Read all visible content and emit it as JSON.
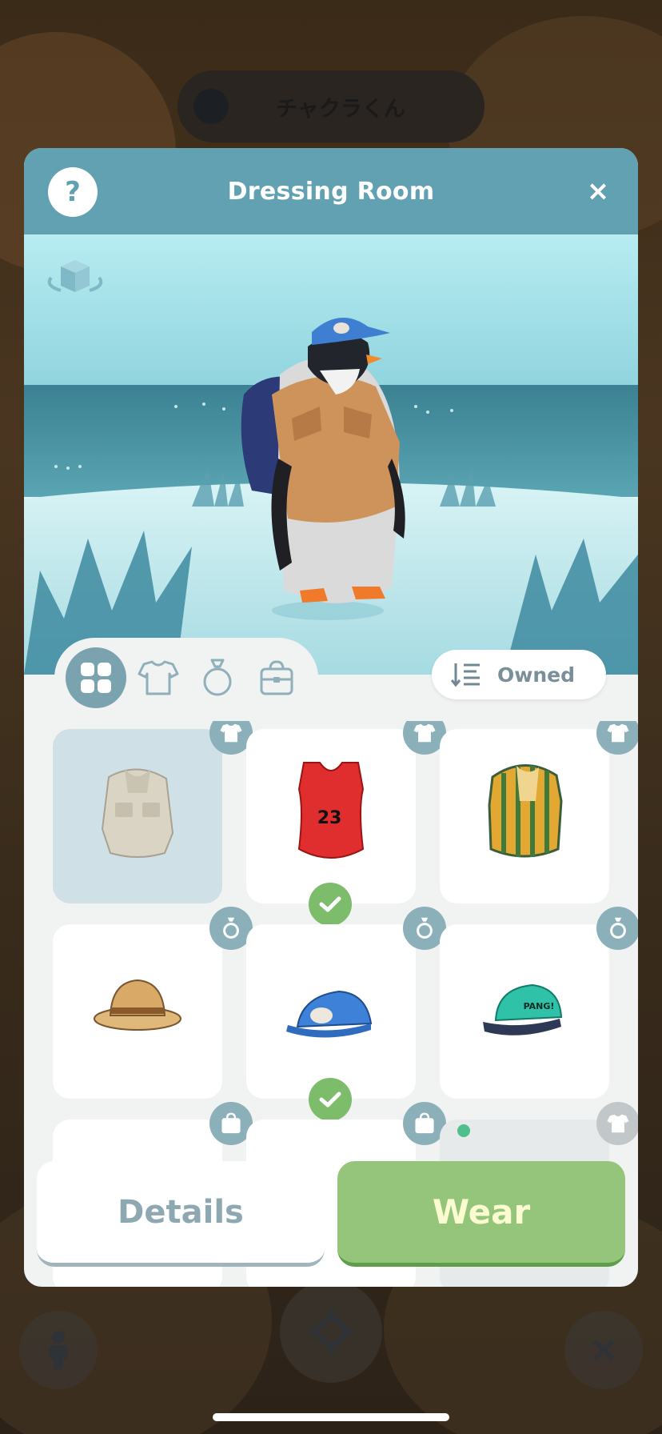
{
  "background": {
    "character_name": "チャクラくん",
    "nav_icons": [
      "person-icon",
      "locate-icon",
      "close-icon"
    ]
  },
  "dialog": {
    "title": "Dressing Room",
    "help_label": "?",
    "close_label": "×"
  },
  "preview": {
    "rotate_icon": "rotate-3d-icon",
    "character": "penguin"
  },
  "tabs": [
    {
      "icon": "grid-icon",
      "active": true
    },
    {
      "icon": "shirt-icon",
      "active": false
    },
    {
      "icon": "ring-icon",
      "active": false
    },
    {
      "icon": "bag-icon",
      "active": false
    }
  ],
  "sort": {
    "label": "Owned",
    "icon": "sort-list-icon"
  },
  "items": [
    {
      "name": "safari-shirt",
      "category": "shirt",
      "selected": true,
      "worn": false
    },
    {
      "name": "basketball-jersey",
      "category": "shirt",
      "selected": false,
      "worn": true,
      "jersey_text": "23"
    },
    {
      "name": "striped-shirt",
      "category": "shirt",
      "selected": false,
      "worn": false
    },
    {
      "name": "safari-hat",
      "category": "accessory",
      "selected": false,
      "worn": false
    },
    {
      "name": "blue-cap",
      "category": "accessory",
      "selected": false,
      "worn": true
    },
    {
      "name": "green-cap",
      "category": "accessory",
      "selected": false,
      "worn": false,
      "cap_text": "PANG!"
    },
    {
      "name": "bag-item-1",
      "category": "bag",
      "selected": false,
      "worn": false
    },
    {
      "name": "bag-item-2",
      "category": "bag",
      "selected": false,
      "worn": true
    },
    {
      "name": "shirt-item-new",
      "category": "shirt",
      "selected": false,
      "worn": false,
      "new": true
    }
  ],
  "actions": {
    "details_label": "Details",
    "wear_label": "Wear"
  },
  "colors": {
    "header": "#62a1b1",
    "wear_button": "#94c57b",
    "check_badge": "#7cbc6a",
    "category_badge": "#8bb0ba"
  }
}
